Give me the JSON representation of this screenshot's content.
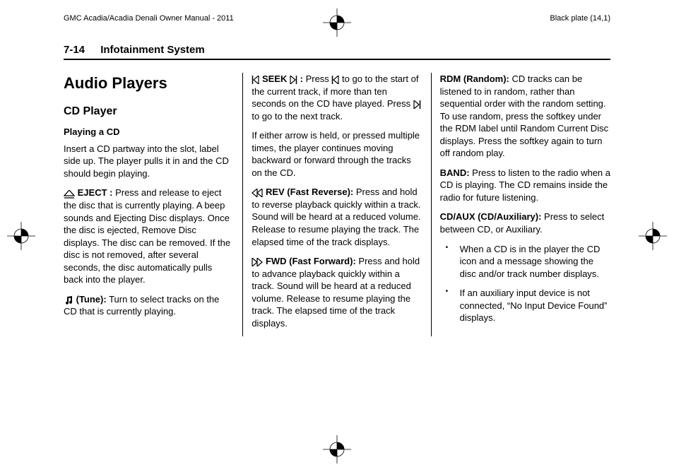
{
  "header": {
    "manual_title": "GMC Acadia/Acadia Denali Owner Manual - 2011",
    "plate": "Black plate (14,1)"
  },
  "page_header": {
    "page_number": "7-14",
    "section": "Infotainment System"
  },
  "col1": {
    "title": "Audio Players",
    "subtitle": "CD Player",
    "subsub": "Playing a CD",
    "p1": "Insert a CD partway into the slot, label side up. The player pulls it in and the CD should begin playing.",
    "eject_label": "EJECT :",
    "eject_text": "  Press and release to eject the disc that is currently playing. A beep sounds and Ejecting Disc displays. Once the disc is ejected, Remove Disc displays. The disc can be removed. If the disc is not removed, after several seconds, the disc automatically pulls back into the player.",
    "tune_label": "(Tune):",
    "tune_text": "  Turn to select tracks on the CD that is currently playing."
  },
  "col2": {
    "seek_label": "SEEK",
    "seek_colon": " :",
    "seek_pre": "  Press ",
    "seek_mid": " to go to the start of the current track, if more than ten seconds on the CD have played. Press ",
    "seek_end": " to go to the next track.",
    "p_hold": "If either arrow is held, or pressed multiple times, the player continues moving backward or forward through the tracks on the CD.",
    "rev_label": "REV (Fast Reverse):",
    "rev_text": "  Press and hold to reverse playback quickly within a track. Sound will be heard at a reduced volume. Release to resume playing the track. The elapsed time of the track displays.",
    "fwd_label": "FWD (Fast Forward):",
    "fwd_text": "  Press and hold to advance playback quickly within a track. Sound will be heard at a reduced volume. Release to resume playing the track. The elapsed time of the track displays."
  },
  "col3": {
    "rdm_label": "RDM (Random):",
    "rdm_text": "  CD tracks can be listened to in random, rather than sequential order with the random setting. To use random, press the softkey under the RDM label until Random Current Disc displays. Press the softkey again to turn off random play.",
    "band_label": "BAND:",
    "band_text": "  Press to listen to the radio when a CD is playing. The CD remains inside the radio for future listening.",
    "cdaux_label": "CD/AUX (CD/Auxiliary):",
    "cdaux_text": "  Press to select between CD, or Auxiliary.",
    "bullet1": "When a CD is in the player the CD icon and a message showing the disc and/or track number displays.",
    "bullet2": "If an auxiliary input device is not connected, “No Input Device Found” displays."
  },
  "icons": {
    "eject": "eject-icon",
    "tune": "tune-icon",
    "seek_prev": "seek-prev-icon",
    "seek_next": "seek-next-icon",
    "rev": "fast-reverse-icon",
    "fwd": "fast-forward-icon",
    "regmark": "registration-mark-icon"
  }
}
